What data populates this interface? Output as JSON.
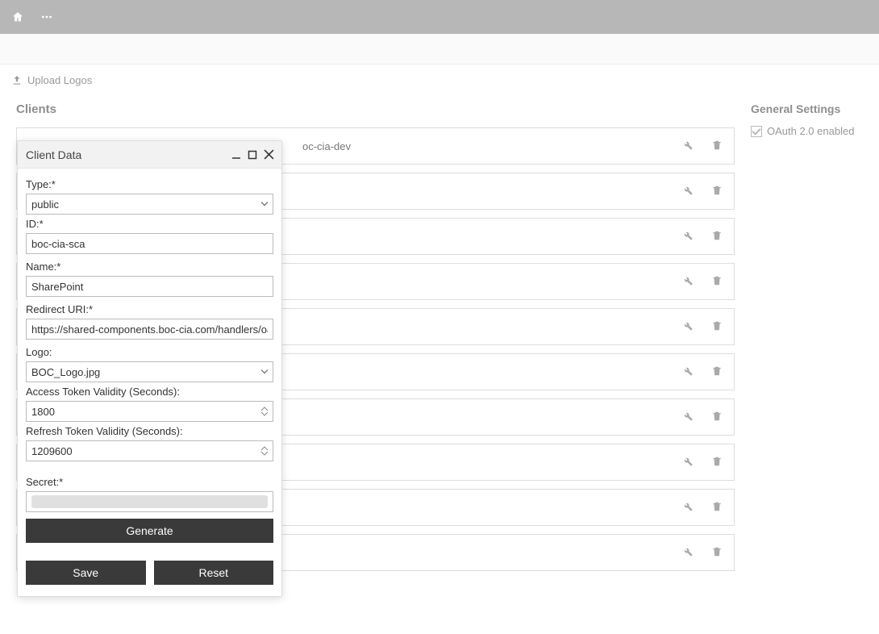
{
  "upload_label": "Upload Logos",
  "clients_heading": "Clients",
  "settings_heading": "General Settings",
  "oauth_label": "OAuth 2.0 enabled",
  "client_visible_label": "oc-cia-dev",
  "modal": {
    "title": "Client Data",
    "type_label": "Type:*",
    "type_value": "public",
    "id_label": "ID:*",
    "id_value": "boc-cia-sca",
    "name_label": "Name:*",
    "name_value": "SharePoint",
    "redirect_label": "Redirect URI:*",
    "redirect_value": "https://shared-components.boc-cia.com/handlers/oa",
    "logo_label": "Logo:",
    "logo_value": "BOC_Logo.jpg",
    "access_label": "Access Token Validity (Seconds):",
    "access_value": "1800",
    "refresh_label": "Refresh Token Validity (Seconds):",
    "refresh_value": "1209600",
    "secret_label": "Secret:*",
    "generate_label": "Generate",
    "save_label": "Save",
    "reset_label": "Reset"
  }
}
